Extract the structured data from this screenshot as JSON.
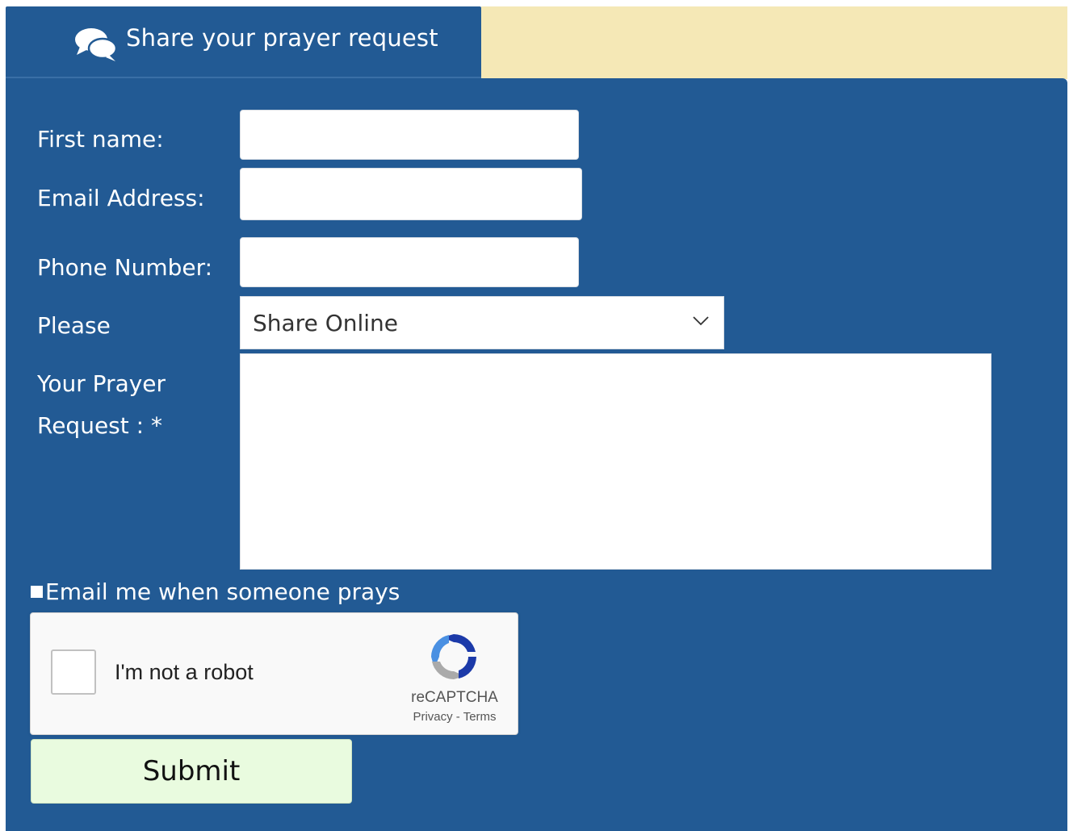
{
  "header": {
    "title": "Share your prayer request",
    "icon": "chat-bubbles-icon"
  },
  "colors": {
    "panel_bg": "#225a94",
    "top_band_bg": "#f5e8b6",
    "submit_bg": "#e9fbdf",
    "text_light": "#ffffff"
  },
  "form": {
    "first_name": {
      "label": "First name:",
      "value": ""
    },
    "email": {
      "label": "Email Address:",
      "value": ""
    },
    "phone": {
      "label": "Phone Number:",
      "value": ""
    },
    "share_option": {
      "label": "Please",
      "selected": "Share Online"
    },
    "prayer_request": {
      "label_line1": "Your Prayer",
      "label_line2": "Request : *",
      "value": ""
    },
    "email_notify": {
      "label": "Email me when someone prays",
      "checked": false
    },
    "submit_label": "Submit"
  },
  "recaptcha": {
    "checkbox_label": "I'm not a robot",
    "brand": "reCAPTCHA",
    "privacy": "Privacy",
    "separator": " - ",
    "terms": "Terms"
  }
}
